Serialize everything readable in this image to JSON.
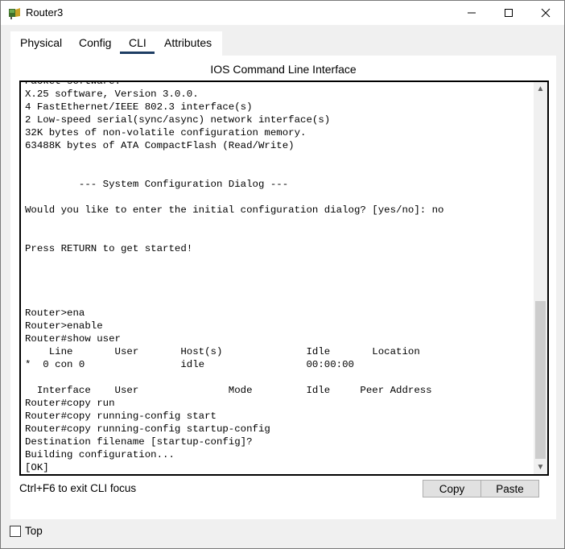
{
  "window": {
    "title": "Router3",
    "controls": {
      "minimize": "—",
      "maximize": "☐",
      "close": "✕"
    }
  },
  "tabs": [
    {
      "label": "Physical",
      "active": false
    },
    {
      "label": "Config",
      "active": false
    },
    {
      "label": "CLI",
      "active": true
    },
    {
      "label": "Attributes",
      "active": false
    }
  ],
  "panel": {
    "title": "IOS Command Line Interface",
    "console_text": "Packet software.\nX.25 software, Version 3.0.0.\n4 FastEthernet/IEEE 802.3 interface(s)\n2 Low-speed serial(sync/async) network interface(s)\n32K bytes of non-volatile configuration memory.\n63488K bytes of ATA CompactFlash (Read/Write)\n\n\n         --- System Configuration Dialog ---\n\nWould you like to enter the initial configuration dialog? [yes/no]: no\n\n\nPress RETURN to get started!\n\n\n\n\nRouter>ena\nRouter>enable\nRouter#show user\n    Line       User       Host(s)              Idle       Location\n*  0 con 0                idle                 00:00:00\n\n  Interface    User               Mode         Idle     Peer Address\nRouter#copy run\nRouter#copy running-config start\nRouter#copy running-config startup-config\nDestination filename [startup-config]?\nBuilding configuration...\n[OK]\nRouter#",
    "scroll_up": "▲",
    "scroll_down": "▼",
    "hint": "Ctrl+F6 to exit CLI focus",
    "copy_label": "Copy",
    "paste_label": "Paste"
  },
  "footer": {
    "top_label": "Top",
    "top_checked": false
  },
  "icons": {
    "app": "router-icon"
  }
}
